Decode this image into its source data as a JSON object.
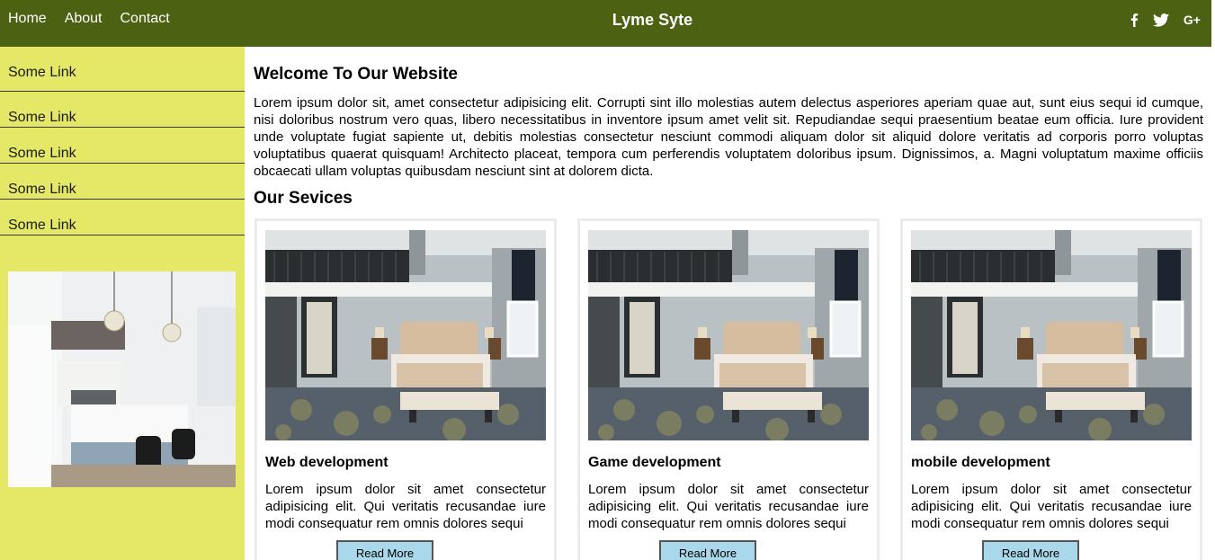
{
  "header": {
    "nav": [
      "Home",
      "About",
      "Contact"
    ],
    "brand": "Lyme Syte",
    "social": {
      "facebook_icon": "facebook-icon",
      "twitter_icon": "twitter-icon",
      "gplus_label": "G+"
    },
    "colors": {
      "bar": "#4c6112",
      "text": "#ffffff"
    }
  },
  "sidebar": {
    "links": [
      "Some Link",
      "Some Link",
      "Some Link",
      "Some Link",
      "Some Link"
    ],
    "photo": "kitchen-photo",
    "colors": {
      "background": "#e5e766"
    }
  },
  "main": {
    "welcome_title": "Welcome To Our Website",
    "intro": "Lorem ipsum dolor sit, amet consectetur adipisicing elit. Corrupti sint illo molestias autem delectus asperiores aperiam quae aut, sunt eius sequi id cumque, nisi doloribus nostrum vero quas, libero necessitatibus in inventore ipsum amet velit sit. Repudiandae sequi praesentium beatae eum officia. Iure provident unde voluptate fugiat sapiente ut, debitis molestias consectetur nesciunt commodi aliquam dolor sit aliquid dolore veritatis ad corporis porro voluptas voluptatibus quaerat quisquam! Architecto placeat, tempora cum perferendis voluptatem doloribus ipsum. Dignissimos, a. Magni voluptatum maxime officiis obcaecati ullam voluptas quibusdam nesciunt sint at dolorem dicta.",
    "services_title": "Our Sevices",
    "cards": [
      {
        "title": "Web development",
        "text": "Lorem ipsum dolor sit amet consectetur adipisicing elit. Qui veritatis recusandae iure modi consequatur rem omnis dolores sequi",
        "button": "Read More"
      },
      {
        "title": "Game development",
        "text": "Lorem ipsum dolor sit amet consectetur adipisicing elit. Qui veritatis recusandae iure modi consequatur rem omnis dolores sequi",
        "button": "Read More"
      },
      {
        "title": "mobile development",
        "text": "Lorem ipsum dolor sit amet consectetur adipisicing elit. Qui veritatis recusandae iure modi consequatur rem omnis dolores sequi",
        "button": "Read More"
      }
    ],
    "card_photo": "bedroom-photo",
    "colors": {
      "button": "#a9d8ea"
    }
  }
}
